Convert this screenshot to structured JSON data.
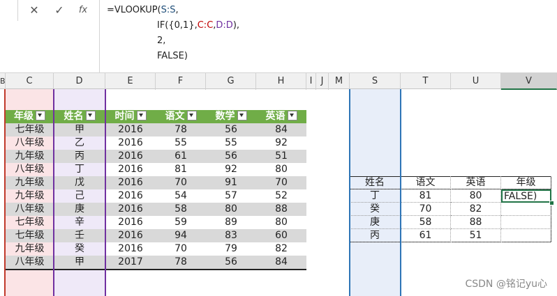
{
  "formula_bar": {
    "cancel_glyph": "✕",
    "enter_glyph": "✓",
    "fx_label": "fx",
    "line1": {
      "a": "=VLOOKUP(",
      "b": "S:S",
      "c": ","
    },
    "line2": {
      "a": "IF({0,1},",
      "b": "C:C",
      "c": ",",
      "d": "D:D",
      "e": "),"
    },
    "line3": "2,",
    "line4": "FALSE)"
  },
  "columns": [
    "B",
    "C",
    "D",
    "E",
    "F",
    "G",
    "H",
    "I",
    "J",
    "M",
    "S",
    "T",
    "U",
    "V"
  ],
  "main_table": {
    "headers": [
      "年级",
      "姓名",
      "时间",
      "语文",
      "数学",
      "英语"
    ],
    "rows": [
      [
        "七年级",
        "甲",
        "2016",
        "78",
        "56",
        "84"
      ],
      [
        "八年级",
        "乙",
        "2016",
        "55",
        "55",
        "92"
      ],
      [
        "九年级",
        "丙",
        "2016",
        "61",
        "56",
        "51"
      ],
      [
        "八年级",
        "丁",
        "2016",
        "81",
        "92",
        "80"
      ],
      [
        "九年级",
        "戊",
        "2016",
        "70",
        "91",
        "70"
      ],
      [
        "九年级",
        "己",
        "2016",
        "54",
        "57",
        "52"
      ],
      [
        "八年级",
        "庚",
        "2016",
        "58",
        "80",
        "88"
      ],
      [
        "七年级",
        "辛",
        "2016",
        "59",
        "89",
        "80"
      ],
      [
        "七年级",
        "壬",
        "2016",
        "94",
        "83",
        "60"
      ],
      [
        "九年级",
        "癸",
        "2016",
        "70",
        "79",
        "82"
      ],
      [
        "八年级",
        "甲",
        "2017",
        "78",
        "56",
        "84"
      ]
    ]
  },
  "lookup_table": {
    "headers": [
      "姓名",
      "语文",
      "英语",
      "年级"
    ],
    "rows": [
      [
        "丁",
        "81",
        "80",
        "FALSE)"
      ],
      [
        "癸",
        "70",
        "82",
        ""
      ],
      [
        "庚",
        "58",
        "88",
        ""
      ],
      [
        "丙",
        "61",
        "51",
        ""
      ]
    ]
  },
  "watermark": "CSDN @铭记yu心",
  "colors": {
    "header_green": "#70ad47",
    "band_pink": "#fbe4e6",
    "band_lavender": "#efe9f8",
    "band_blue": "#e8eef9",
    "row_gray": "#d9d9d9"
  }
}
